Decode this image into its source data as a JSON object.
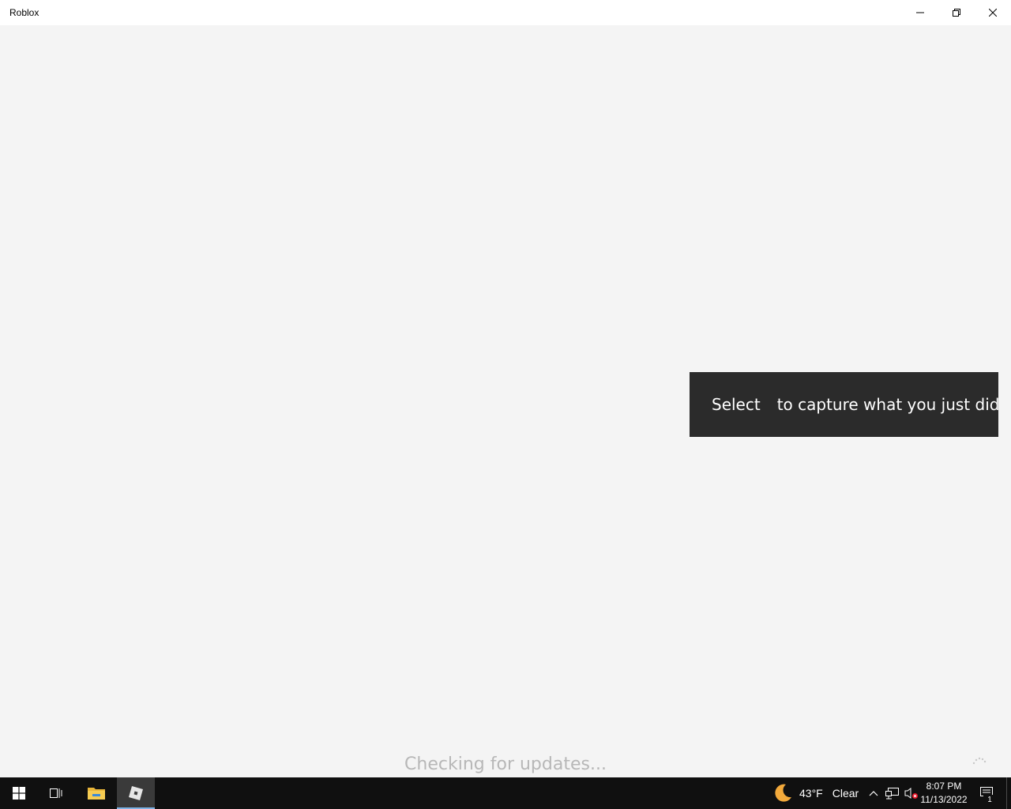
{
  "window": {
    "title": "Roblox",
    "controls": [
      "minimize-icon",
      "restore-icon",
      "close-icon"
    ]
  },
  "main": {
    "status_text": "Checking for updates..."
  },
  "toast": {
    "prefix": "Select",
    "icon": "capture-icon",
    "suffix": "to capture what you just did"
  },
  "taskbar": {
    "items": [
      {
        "name": "start-button",
        "icon": "windows-logo-icon"
      },
      {
        "name": "task-view-button",
        "icon": "task-view-icon"
      },
      {
        "name": "file-explorer-button",
        "icon": "folder-icon"
      },
      {
        "name": "roblox-button",
        "icon": "roblox-icon",
        "active": true
      }
    ],
    "weather": {
      "icon": "moon-icon",
      "temperature": "43°F",
      "condition": "Clear"
    },
    "tray": [
      "chevron-up-icon",
      "network-icon",
      "volume-muted-icon"
    ],
    "clock": {
      "time": "8:07 PM",
      "date": "11/13/2022"
    },
    "notifications": {
      "icon": "notification-icon",
      "count": "1"
    }
  },
  "colors": {
    "taskbar_bg": "#101010",
    "toast_bg": "#2b2b2b",
    "content_bg": "#f4f4f4",
    "status_text": "#b7b7b7",
    "active_indicator": "#7fb3e6"
  }
}
